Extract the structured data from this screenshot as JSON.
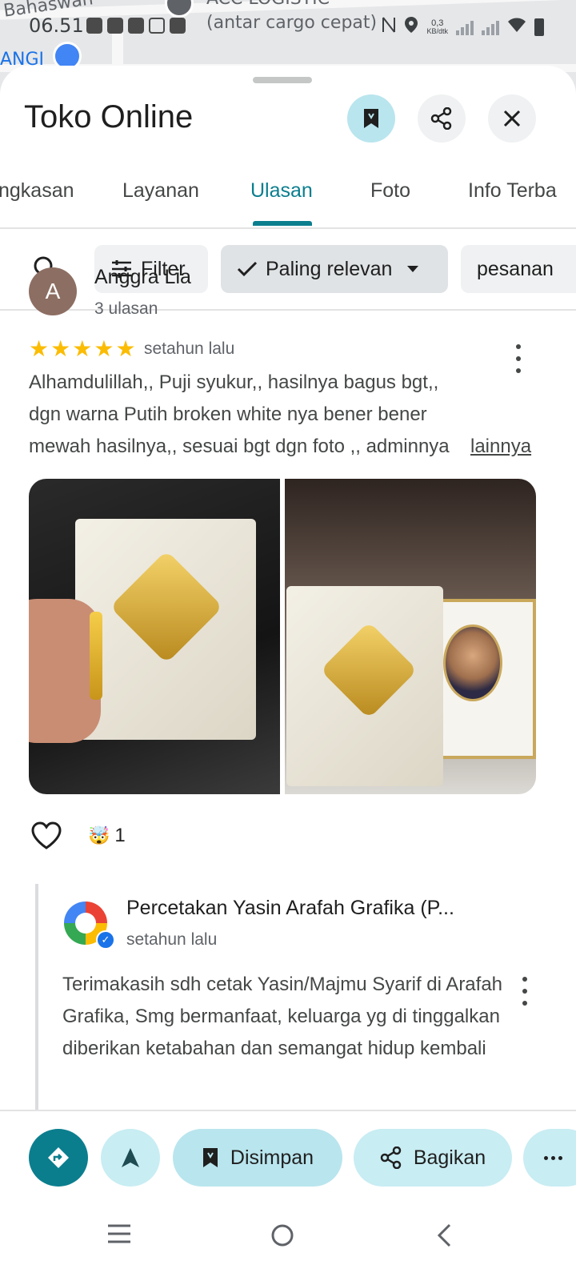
{
  "map": {
    "labels": [
      "Bahaswan",
      "ACC LOGISTIC",
      "(antar cargo cepat)",
      "ANGI"
    ]
  },
  "status_bar": {
    "time": "06.51",
    "speed_value": "0,3",
    "speed_unit": "KB/dtk"
  },
  "header": {
    "title": "Toko Online"
  },
  "tabs": [
    {
      "label": "Ringkasan",
      "visible": "ngkasan"
    },
    {
      "label": "Layanan"
    },
    {
      "label": "Ulasan",
      "active": true
    },
    {
      "label": "Foto"
    },
    {
      "label": "Info Terbaru",
      "visible": "Info Terba"
    }
  ],
  "filters": {
    "filter_label": "Filter",
    "sort_label": "Paling relevan",
    "topic_chip": "pesanan"
  },
  "review": {
    "avatar_letter": "A",
    "name": "Anggra Lia",
    "review_count": "3 ulasan",
    "rating": 5,
    "time": "setahun lalu",
    "text": "Alhamdulillah,, Puji syukur,, hasilnya bagus bgt,, dgn warna Putih broken white nya bener bener mewah hasilnya,, sesuai  bgt dgn foto ,, adminnya yg...",
    "more_label": "lainnya",
    "reaction_count": "1"
  },
  "owner_reply": {
    "name": "Percetakan Yasin Arafah Grafika (P...",
    "time": "setahun lalu",
    "text": "Terimakasih sdh cetak Yasin/Majmu Syarif di Arafah Grafika, Smg bermanfaat, keluarga yg di tinggalkan diberikan ketabahan dan semangat hidup kembali"
  },
  "action_bar": {
    "saved_label": "Disimpan",
    "share_label": "Bagikan"
  },
  "colors": {
    "accent": "#0b7e8e",
    "saved_bg": "#b9e5ee",
    "star": "#fbbc04"
  }
}
